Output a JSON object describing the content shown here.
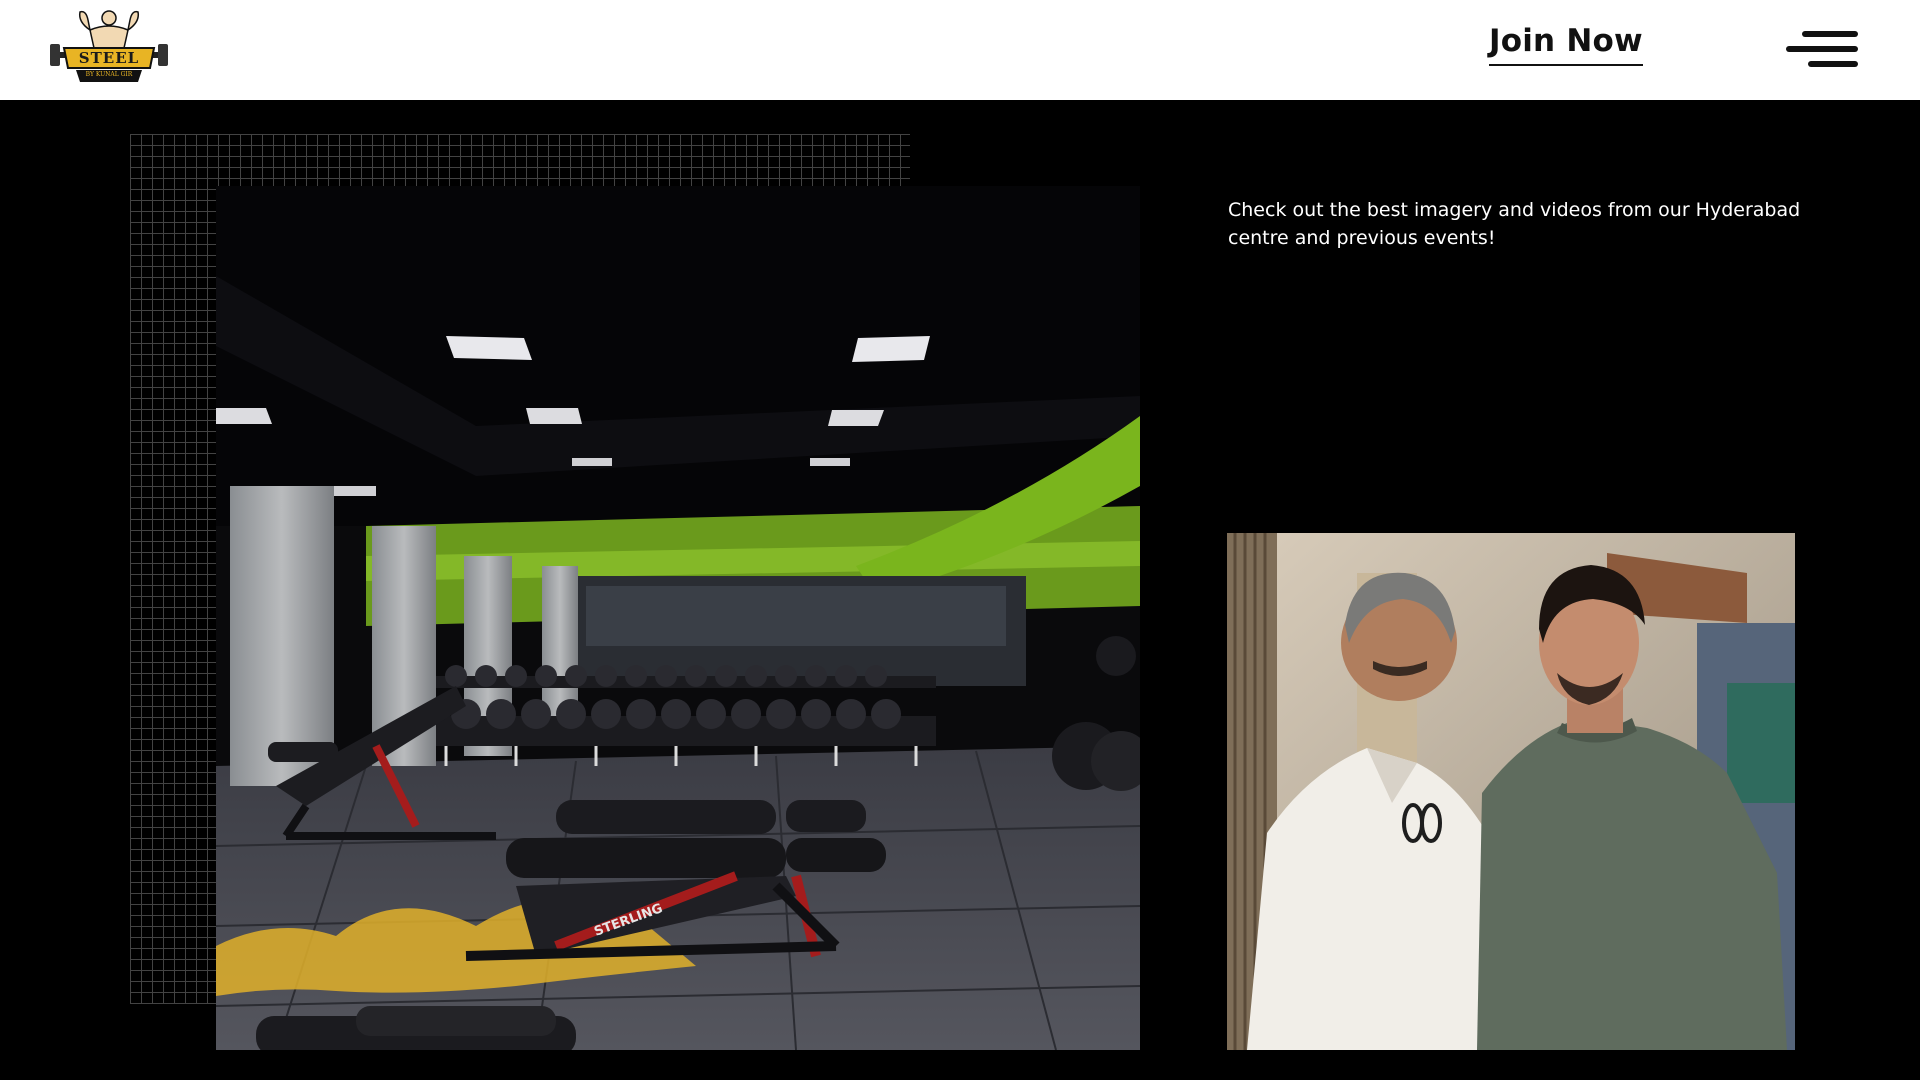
{
  "header": {
    "logo": {
      "brand_text": "STEEL",
      "tagline_text": "BY KUNAL GIR",
      "icon": "bodybuilder-dumbbell-logo"
    },
    "join_label": "Join Now",
    "menu_icon": "hamburger-menu-icon"
  },
  "main": {
    "description": "Check out the best imagery and videos from our Hyderabad centre and previous events!",
    "gallery": [
      {
        "name": "gym-interior-photo",
        "bench_brand_text": "STERLING"
      },
      {
        "name": "people-photo"
      }
    ]
  },
  "colors": {
    "header_bg": "#ffffff",
    "page_bg": "#000000",
    "accent_green": "#7ab51d",
    "logo_gold": "#e8b424",
    "text_light": "#ffffff",
    "text_dark": "#111111"
  }
}
